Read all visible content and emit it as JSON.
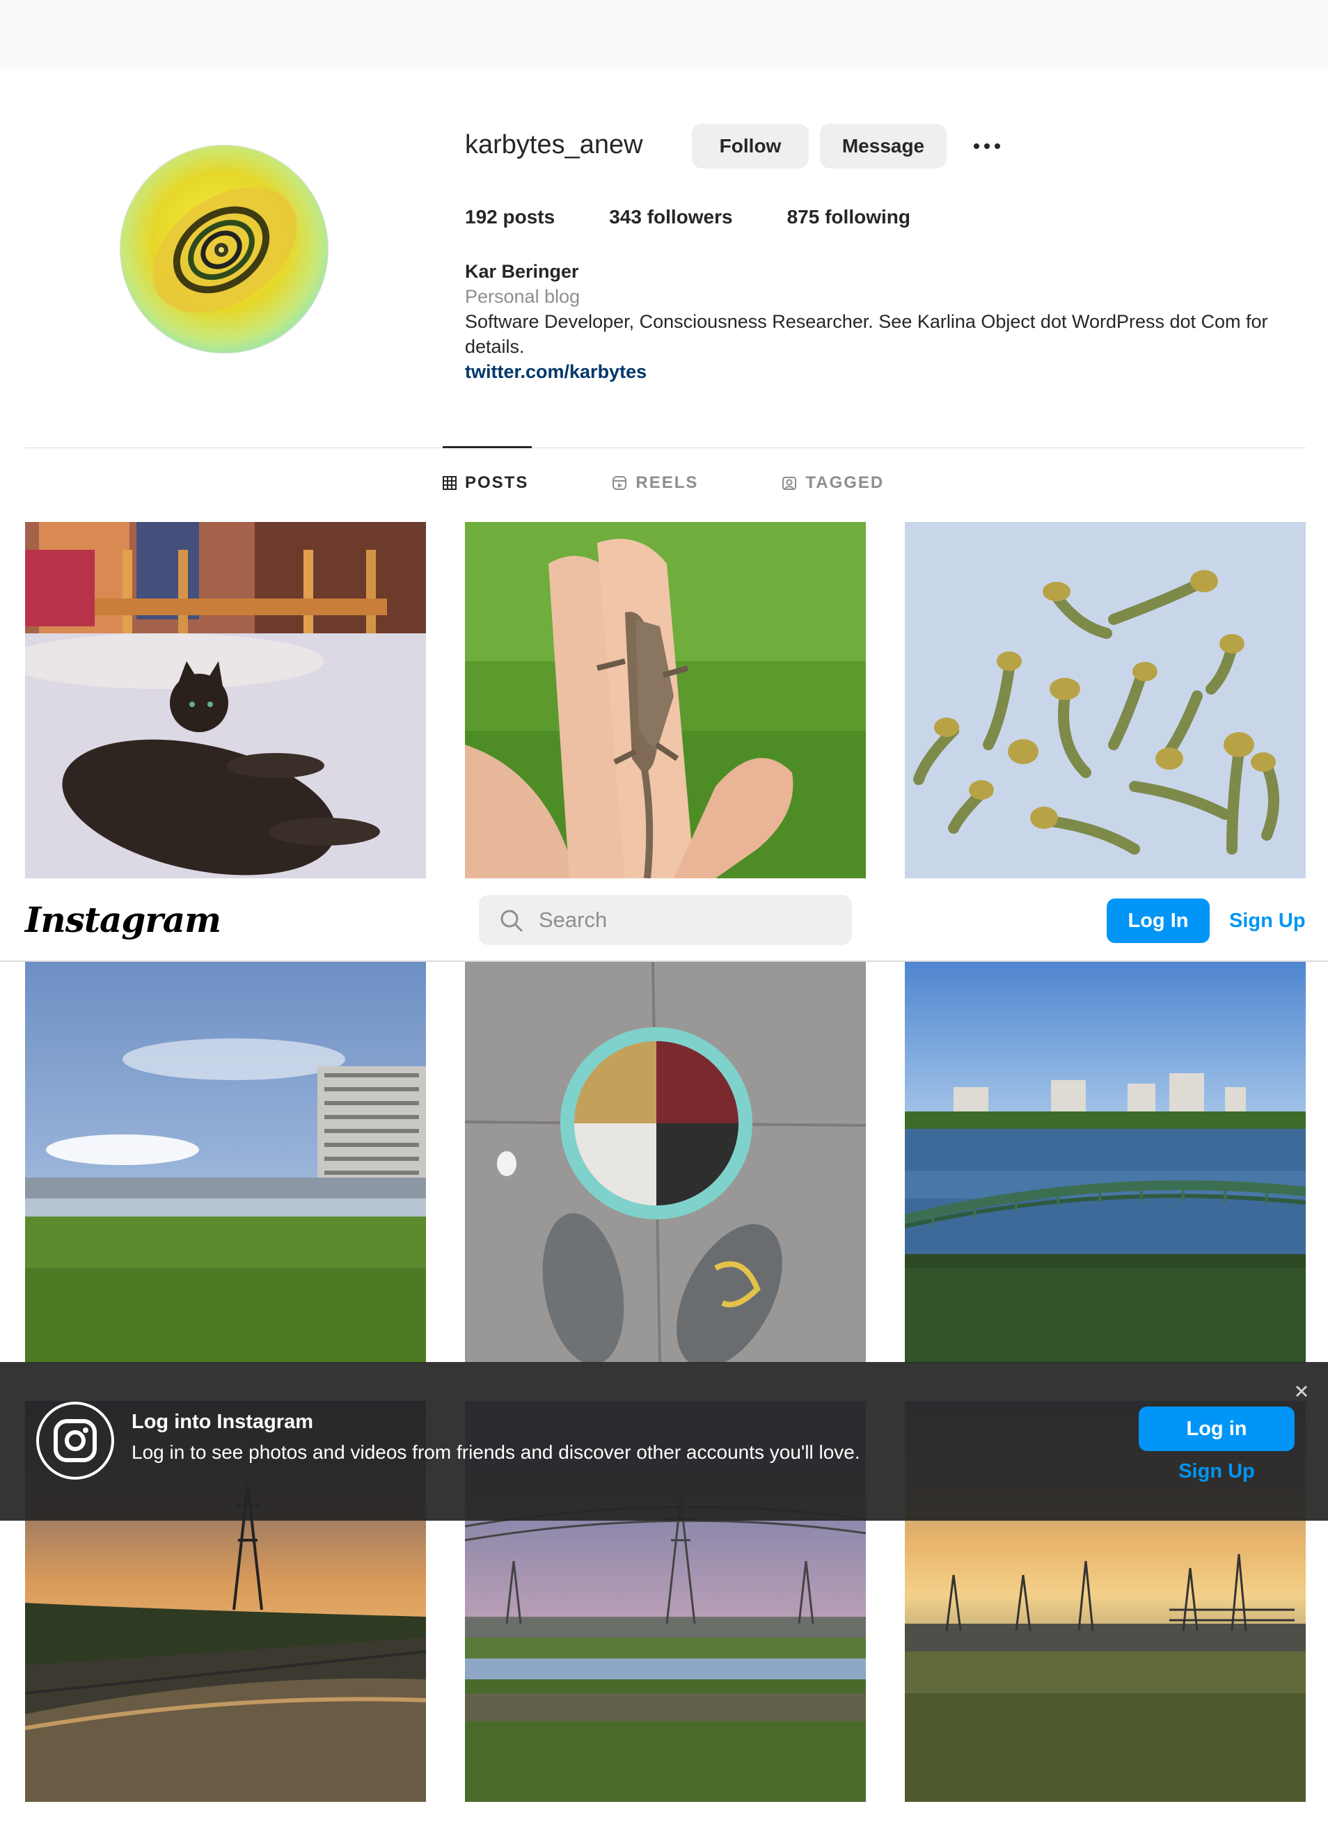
{
  "profile": {
    "username": "karbytes_anew",
    "follow_label": "Follow",
    "message_label": "Message",
    "more_icon": "more-horizontal-icon",
    "stats": {
      "posts_count": "192",
      "posts_label": "posts",
      "followers_count": "343",
      "followers_label": "followers",
      "following_count": "875",
      "following_label": "following"
    },
    "bio": {
      "name": "Kar Beringer",
      "category": "Personal blog",
      "description": "Software Developer, Consciousness Researcher. See Karlina Object dot WordPress dot Com for details.",
      "link": "twitter.com/karbytes"
    }
  },
  "tabs": [
    {
      "label": "POSTS",
      "icon": "grid-icon",
      "active": true
    },
    {
      "label": "REELS",
      "icon": "reels-icon",
      "active": false
    },
    {
      "label": "TAGGED",
      "icon": "tagged-icon",
      "active": false
    }
  ],
  "navbar": {
    "logo": "Instagram",
    "search_placeholder": "Search",
    "login_label": "Log In",
    "signup_label": "Sign Up"
  },
  "banner": {
    "title": "Log into Instagram",
    "subtitle": "Log in to see photos and videos from friends and discover other accounts you'll love.",
    "login_label": "Log in",
    "signup_label": "Sign Up",
    "close_icon": "close-icon"
  },
  "colors": {
    "accent": "#0095f6",
    "link": "#00376b",
    "text": "#262626",
    "muted": "#8e8e8e",
    "button_grey": "#efefef"
  }
}
